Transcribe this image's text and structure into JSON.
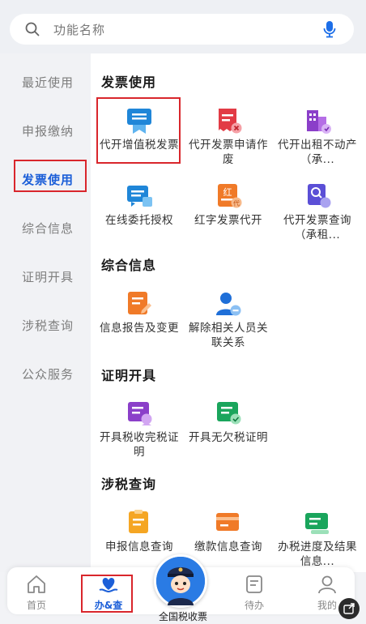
{
  "search": {
    "placeholder": "功能名称"
  },
  "sidebar": {
    "items": [
      {
        "label": "最近使用"
      },
      {
        "label": "申报缴纳"
      },
      {
        "label": "发票使用",
        "active": true
      },
      {
        "label": "综合信息"
      },
      {
        "label": "证明开具"
      },
      {
        "label": "涉税查询"
      },
      {
        "label": "公众服务"
      }
    ]
  },
  "sections": [
    {
      "title": "发票使用",
      "tiles": [
        {
          "label": "代开增值税发票",
          "icon": "invoice-ribbon-icon"
        },
        {
          "label": "代开发票申请作废",
          "icon": "invoice-cancel-icon"
        },
        {
          "label": "代开出租不动产（承...",
          "icon": "building-invoice-icon"
        },
        {
          "label": "在线委托授权",
          "icon": "delegate-card-icon"
        },
        {
          "label": "红字发票代开",
          "icon": "red-invoice-icon"
        },
        {
          "label": "代开发票查询（承租...",
          "icon": "invoice-search-icon"
        }
      ]
    },
    {
      "title": "综合信息",
      "tiles": [
        {
          "label": "信息报告及变更",
          "icon": "report-edit-icon"
        },
        {
          "label": "解除相关人员关联关系",
          "icon": "person-remove-icon"
        }
      ]
    },
    {
      "title": "证明开具",
      "tiles": [
        {
          "label": "开具税收完税证明",
          "icon": "tax-certificate-icon"
        },
        {
          "label": "开具无欠税证明",
          "icon": "no-arrears-certificate-icon"
        }
      ]
    },
    {
      "title": "涉税查询",
      "tiles": [
        {
          "label": "申报信息查询",
          "icon": "declaration-query-icon"
        },
        {
          "label": "缴款信息查询",
          "icon": "payment-query-icon"
        },
        {
          "label": "办税进度及结果信息...",
          "icon": "progress-query-icon"
        }
      ]
    }
  ],
  "bottom_nav": {
    "items": [
      {
        "label": "首页",
        "icon": "home-icon"
      },
      {
        "label": "办&查",
        "icon": "heart-hand-icon",
        "active": true
      },
      {
        "label": "待办",
        "icon": "todo-icon"
      },
      {
        "label": "我的",
        "icon": "user-icon"
      }
    ],
    "center_label": "全国税收票"
  },
  "colors": {
    "accent": "#1c5fd8",
    "highlight_box": "#d9262c",
    "sidebar_bg": "#f1f2f5"
  }
}
